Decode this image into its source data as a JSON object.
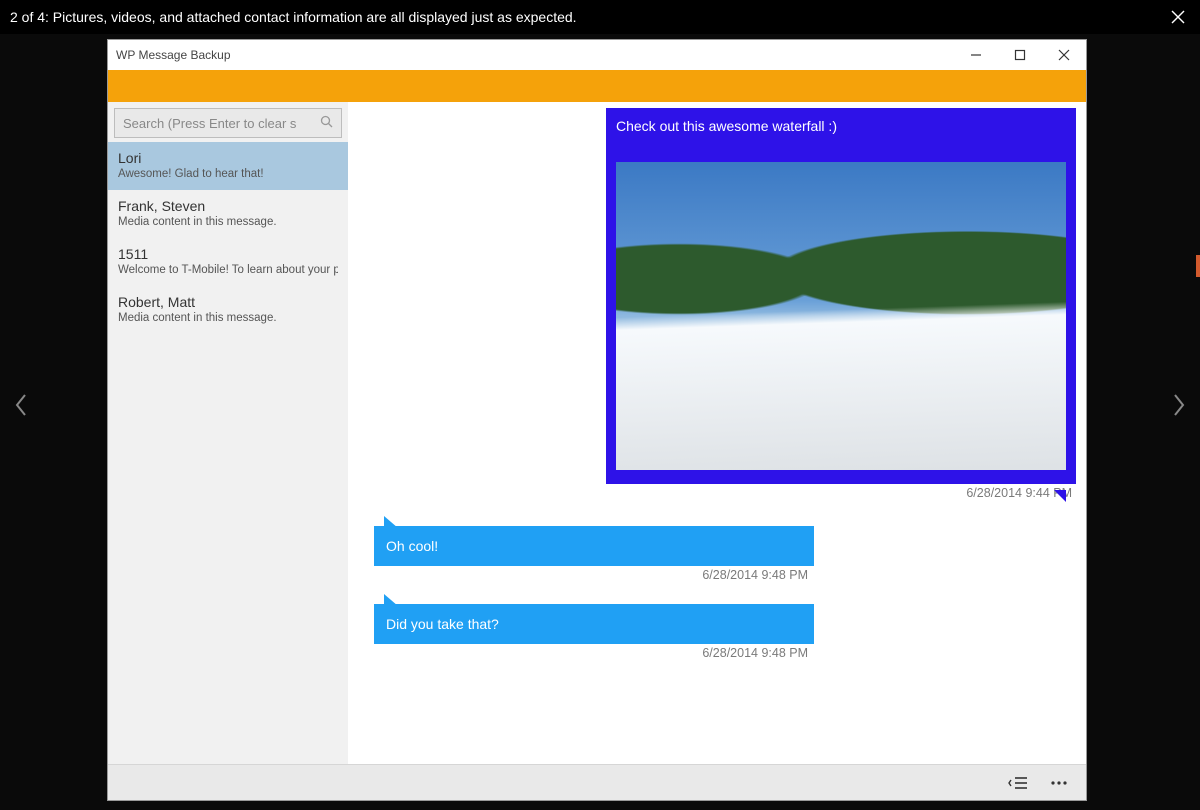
{
  "viewer": {
    "caption": "2 of 4: Pictures, videos, and attached contact information are all displayed just as expected."
  },
  "window": {
    "title": "WP Message Backup"
  },
  "search": {
    "placeholder": "Search (Press Enter to clear s"
  },
  "conversations": [
    {
      "name": "Lori",
      "preview": "Awesome! Glad to hear that!",
      "selected": true
    },
    {
      "name": "Frank, Steven",
      "preview": "Media content in this message.",
      "selected": false
    },
    {
      "name": "1511",
      "preview": "Welcome to T-Mobile! To learn about your p",
      "selected": false
    },
    {
      "name": "Robert, Matt",
      "preview": "Media content in this message.",
      "selected": false
    }
  ],
  "messages": {
    "incoming_media": {
      "caption": "Check out this awesome waterfall :)",
      "timestamp": "6/28/2014 9:44 PM"
    },
    "out1": {
      "text": "Oh cool!",
      "timestamp": "6/28/2014 9:48 PM"
    },
    "out2": {
      "text": "Did you take that?",
      "timestamp": "6/28/2014 9:48 PM"
    }
  },
  "colors": {
    "accent_orange": "#f5a20a",
    "incoming_blue": "#2e12e8",
    "outgoing_blue": "#20a0f4",
    "sidebar_selected": "#a9c8df"
  }
}
